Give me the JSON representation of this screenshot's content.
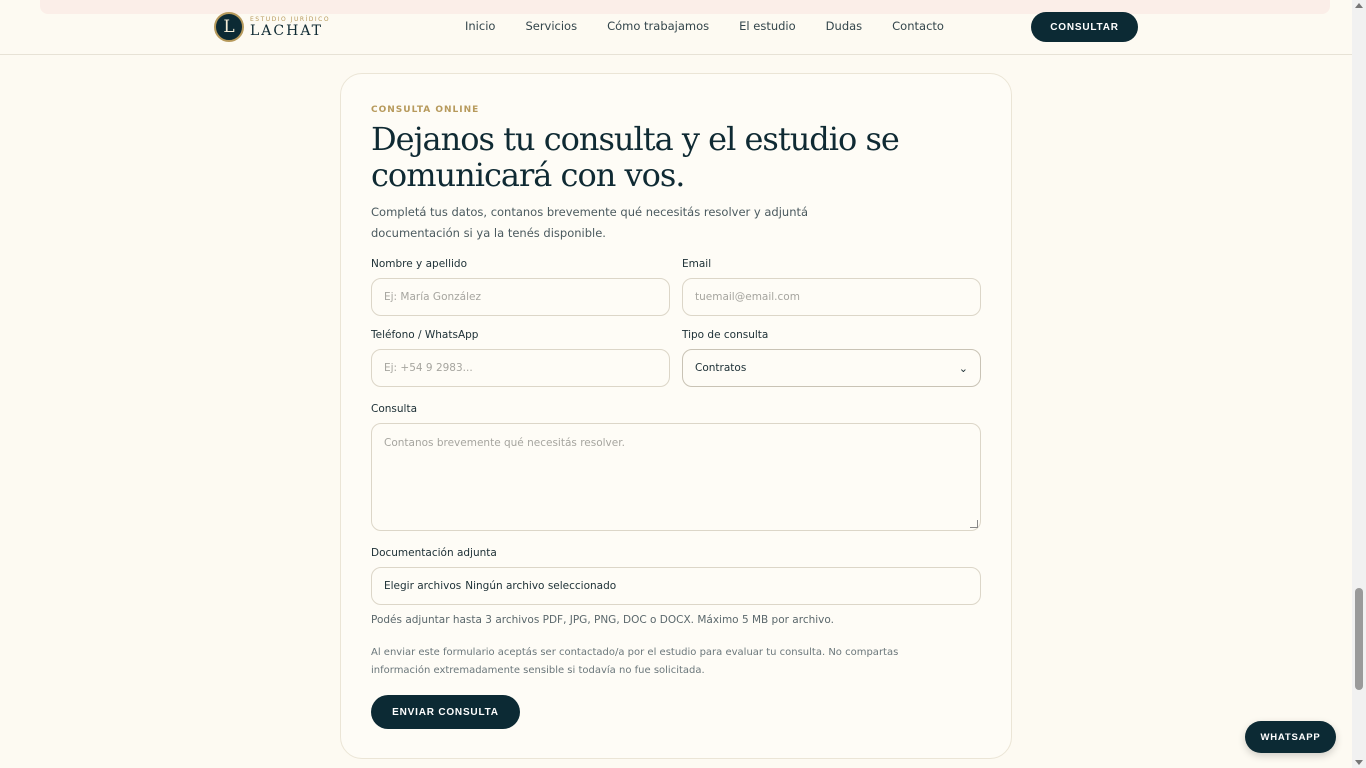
{
  "header": {
    "logo_letter": "L",
    "logo_small": "Estudio Jurídico",
    "logo_name": "LACHAT",
    "nav": [
      "Inicio",
      "Servicios",
      "Cómo trabajamos",
      "El estudio",
      "Dudas",
      "Contacto"
    ],
    "cta_label": "CONSULTAR"
  },
  "form": {
    "eyebrow": "CONSULTA ONLINE",
    "title": "Dejanos tu consulta y el estudio se comunicará con vos.",
    "intro": "Completá tus datos, contanos brevemente qué necesitás resolver y adjuntá documentación si ya la tenés disponible.",
    "name_label": "Nombre y apellido",
    "name_placeholder": "Ej: María González",
    "email_label": "Email",
    "email_placeholder": "tuemail@email.com",
    "phone_label": "Teléfono / WhatsApp",
    "phone_placeholder": "Ej: +54 9 2983...",
    "type_label": "Tipo de consulta",
    "type_value": "Contratos",
    "message_label": "Consulta",
    "message_placeholder": "Contanos brevemente qué necesitás resolver.",
    "file_label": "Documentación adjunta",
    "file_button": "Elegir archivos",
    "file_status": "Ningún archivo seleccionado",
    "file_hint": "Podés adjuntar hasta 3 archivos PDF, JPG, PNG, DOC o DOCX. Máximo 5 MB por archivo.",
    "legal": "Al enviar este formulario aceptás ser contactado/a por el estudio para evaluar tu consulta. No compartas información extremadamente sensible si todavía no fue solicitada.",
    "submit_label": "ENVIAR CONSULTA"
  },
  "whatsapp_label": "WHATSAPP",
  "colors": {
    "background": "#fdfaf2",
    "primary": "#0c2a34",
    "accent": "#b79a5c"
  }
}
